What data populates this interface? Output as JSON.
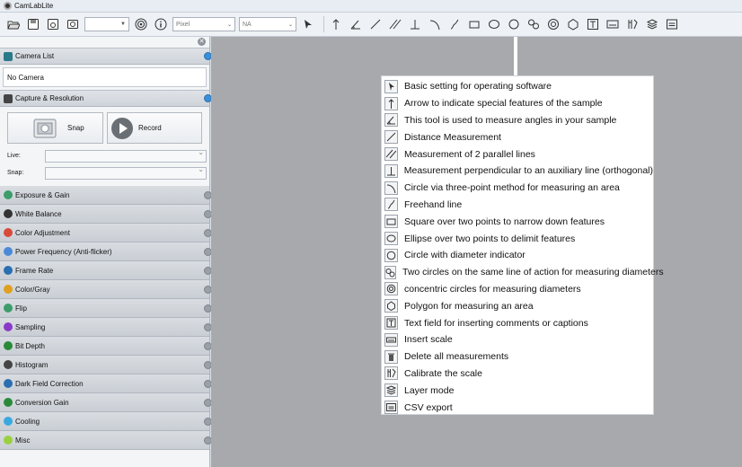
{
  "window": {
    "title": "CamLabLite"
  },
  "toolbar": {
    "unit_value": "Pixel",
    "mag_value": "NA"
  },
  "panel": {
    "camera_list": {
      "title": "Camera List",
      "empty_text": "No Camera"
    },
    "capture": {
      "title": "Capture & Resolution",
      "snap_label": "Snap",
      "record_label": "Record",
      "live_label": "Live:",
      "snap_res_label": "Snap:"
    },
    "sections": [
      {
        "label": "Exposure & Gain",
        "icon": "exposure-icon",
        "color": "#3c9c6a"
      },
      {
        "label": "White Balance",
        "icon": "white-balance-icon",
        "color": "#333333"
      },
      {
        "label": "Color Adjustment",
        "icon": "color-adjustment-icon",
        "color": "#d84a3a"
      },
      {
        "label": "Power Frequency (Anti-flicker)",
        "icon": "power-frequency-icon",
        "color": "#4a8ad8"
      },
      {
        "label": "Frame Rate",
        "icon": "frame-rate-icon",
        "color": "#2a6fb0"
      },
      {
        "label": "Color/Gray",
        "icon": "color-gray-icon",
        "color": "#e0a020"
      },
      {
        "label": "Flip",
        "icon": "flip-icon",
        "color": "#3c9c6a"
      },
      {
        "label": "Sampling",
        "icon": "sampling-icon",
        "color": "#8a3ac8"
      },
      {
        "label": "Bit Depth",
        "icon": "bit-depth-icon",
        "color": "#2a8a3a"
      },
      {
        "label": "Histogram",
        "icon": "histogram-icon",
        "color": "#444444"
      },
      {
        "label": "Dark Field Correction",
        "icon": "dark-field-icon",
        "color": "#2a6fb0"
      },
      {
        "label": "Conversion Gain",
        "icon": "conversion-gain-icon",
        "color": "#2a8a3a"
      },
      {
        "label": "Cooling",
        "icon": "cooling-icon",
        "color": "#3aa8e0"
      },
      {
        "label": "Misc",
        "icon": "misc-icon",
        "color": "#9ad040"
      }
    ]
  },
  "legend": {
    "items": [
      {
        "icon": "pointer-icon",
        "text": "Basic setting for operating software"
      },
      {
        "icon": "arrow-icon",
        "text": "Arrow to indicate special features of the sample"
      },
      {
        "icon": "angle-icon",
        "text": "This tool is used to measure angles in your sample"
      },
      {
        "icon": "line-icon",
        "text": "Distance Measurement"
      },
      {
        "icon": "parallel-lines-icon",
        "text": "Measurement of 2 parallel lines"
      },
      {
        "icon": "perpendicular-icon",
        "text": "Measurement perpendicular to an auxiliary line (orthogonal)"
      },
      {
        "icon": "arc-icon",
        "text": "Circle via three-point method for measuring an area"
      },
      {
        "icon": "freehand-icon",
        "text": "Freehand line"
      },
      {
        "icon": "rectangle-icon",
        "text": "Square over two points to narrow down features"
      },
      {
        "icon": "ellipse-icon",
        "text": "Ellipse over two points to delimit features"
      },
      {
        "icon": "circle-icon",
        "text": "Circle with diameter indicator"
      },
      {
        "icon": "two-circles-icon",
        "text": "Two circles on the same line of action for measuring diameters"
      },
      {
        "icon": "concentric-circles-icon",
        "text": "concentric circles for measuring diameters"
      },
      {
        "icon": "polygon-icon",
        "text": "Polygon for measuring an area"
      },
      {
        "icon": "text-field-icon",
        "text": "Text field for inserting comments or captions"
      },
      {
        "icon": "scale-icon",
        "text": "Insert scale"
      },
      {
        "icon": "delete-icon",
        "text": "Delete all measurements"
      },
      {
        "icon": "calibrate-icon",
        "text": "Calibrate the scale"
      },
      {
        "icon": "layer-icon",
        "text": "Layer mode"
      },
      {
        "icon": "csv-icon",
        "text": "CSV export"
      }
    ]
  }
}
